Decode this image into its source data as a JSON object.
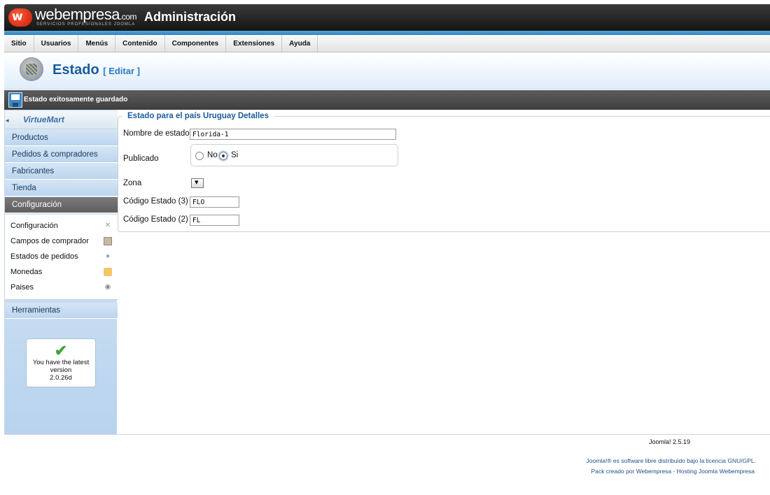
{
  "header": {
    "logo_text": "webempresa",
    "logo_suffix": ".com",
    "logo_tagline": "SERVICIOS PROFESIONALES JOOMLA",
    "title": "Administración"
  },
  "menu": {
    "items": [
      "Sitio",
      "Usuarios",
      "Menús",
      "Contenido",
      "Componentes",
      "Extensiones",
      "Ayuda"
    ]
  },
  "page": {
    "title": "Estado",
    "subtitle": "[ Editar ]"
  },
  "message": "Estado exitosamente guardado",
  "sidebar": {
    "brand": "VirtueMart",
    "sections": [
      "Productos",
      "Pedidos & compradores",
      "Fabricantes",
      "Tienda",
      "Configuración"
    ],
    "sub_items": [
      {
        "label": "Configuración",
        "icon": "wrench-icon"
      },
      {
        "label": "Campos de comprador",
        "icon": "user-fields-icon"
      },
      {
        "label": "Estados de pedidos",
        "icon": "order-status-icon"
      },
      {
        "label": "Monedas",
        "icon": "coins-icon"
      },
      {
        "label": "Paises",
        "icon": "globe-icon"
      }
    ],
    "tools": "Herramientas",
    "version_text": "You have the latest version",
    "version": "2.0.26d"
  },
  "form": {
    "legend": "Estado para el país Uruguay Detalles",
    "state_name_label": "Nombre de estado",
    "state_name_value": "Florida-1",
    "published_label": "Publicado",
    "published_options": [
      "No",
      "Si"
    ],
    "published_selected": "Si",
    "zone_label": "Zona",
    "code3_label": "Código Estado (3)",
    "code3_value": "FLO",
    "code2_label": "Código Estado (2)",
    "code2_value": "FL"
  },
  "footer": {
    "version": "Joomla! 2.5.19",
    "license": "Joomla!® es software libre distribuido bajo la licencia GNU/GPL.",
    "pack": "Pack creado por Webempresa - Hosting Joomla Webempresa"
  }
}
